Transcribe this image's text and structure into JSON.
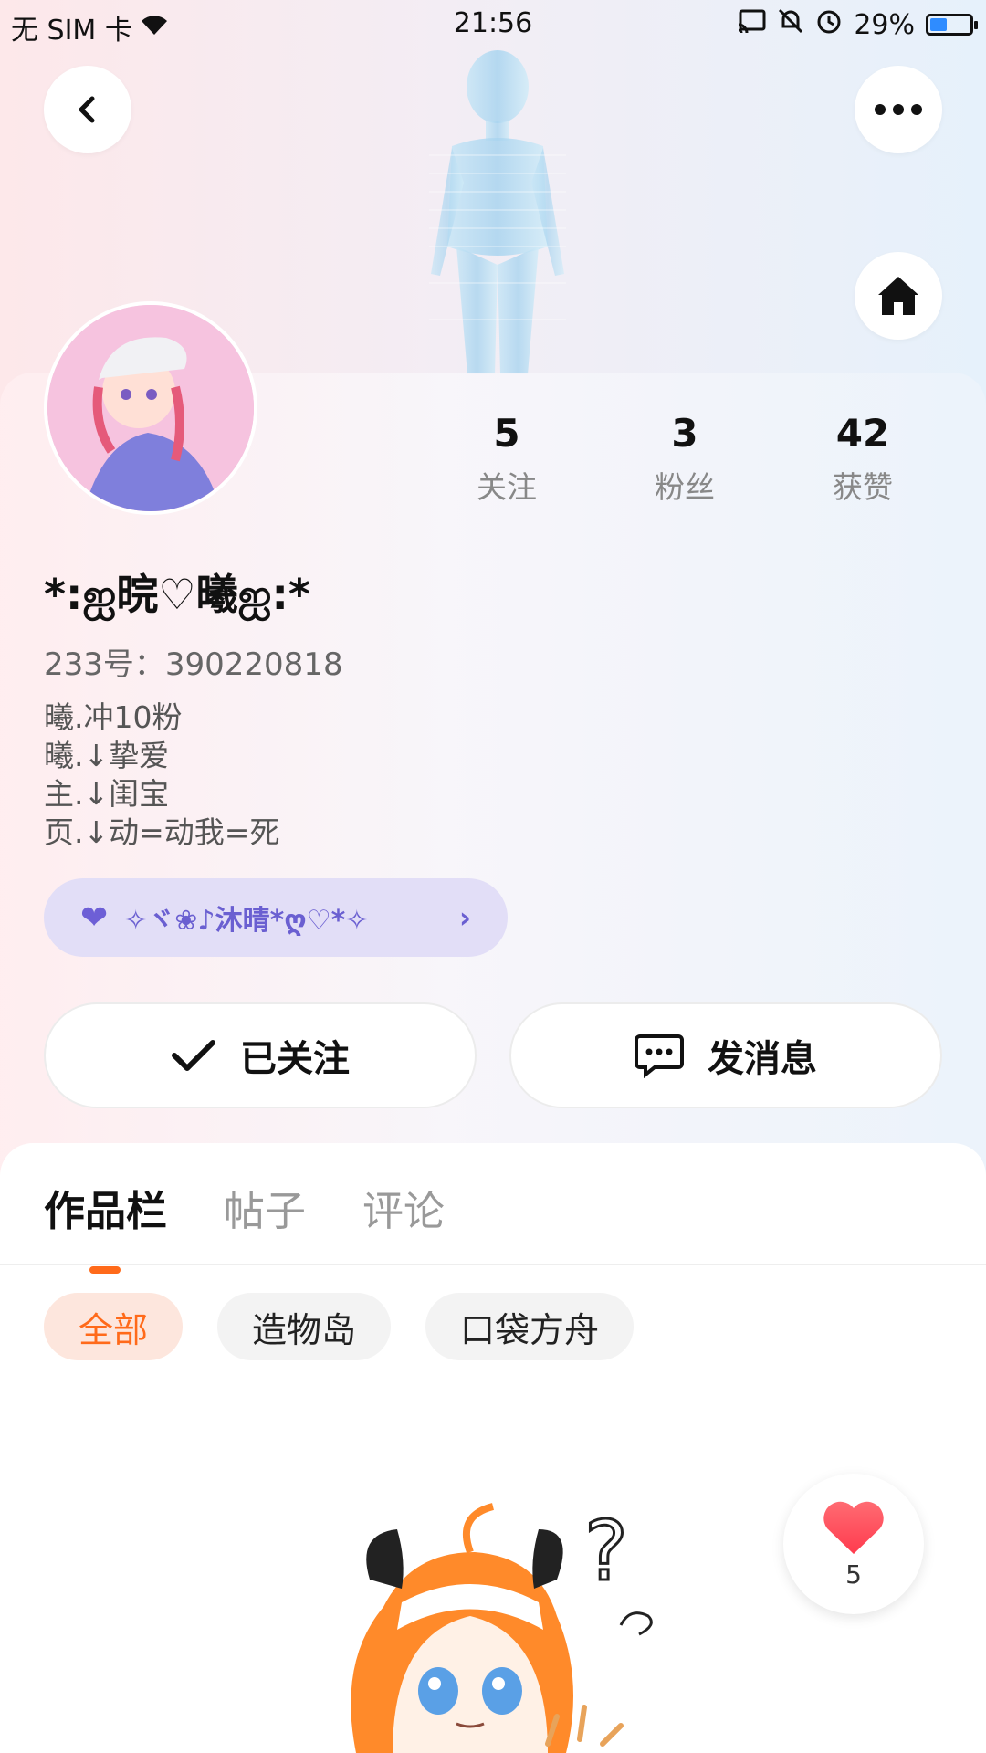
{
  "status_bar": {
    "carrier": "无 SIM 卡",
    "time": "21:56",
    "battery": "29%"
  },
  "profile": {
    "name": "*:ஐ晥♡曦ஐ:*",
    "id_label": "233号：390220818",
    "bio": [
      "曦.冲10粉",
      "曦.↓挚爱",
      "主.↓闺宝",
      "页.↓动=动我=死"
    ],
    "badge_text": "✧ヾ❀♪沐晴*ღ♡*✧",
    "stats": [
      {
        "num": "5",
        "label": "关注"
      },
      {
        "num": "3",
        "label": "粉丝"
      },
      {
        "num": "42",
        "label": "获赞"
      }
    ]
  },
  "actions": {
    "follow_label": "已关注",
    "message_label": "发消息"
  },
  "tabs": [
    "作品栏",
    "帖子",
    "评论"
  ],
  "filters": [
    "全部",
    "造物岛",
    "口袋方舟"
  ],
  "like_fab": {
    "count": "5"
  },
  "colors": {
    "accent": "#ff6a1a",
    "badge_bg": "#e2def7",
    "badge_text": "#6a5fd1",
    "heart": "#ff4d5e"
  }
}
